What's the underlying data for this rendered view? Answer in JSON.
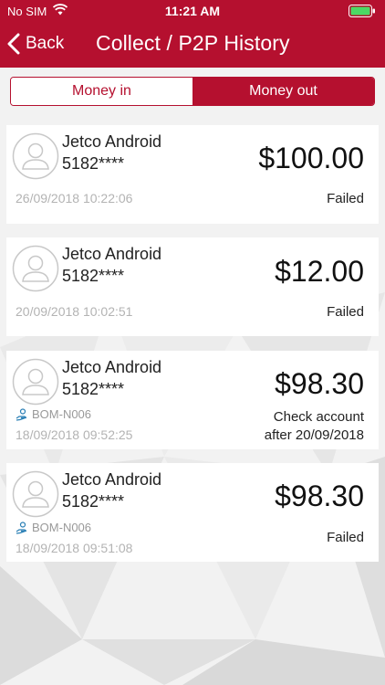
{
  "status_bar": {
    "carrier": "No SIM",
    "time": "11:21 AM",
    "icons": [
      "wifi-icon",
      "battery-icon"
    ]
  },
  "nav": {
    "back_label": "Back",
    "title": "Collect / P2P History",
    "back_icon": "chevron-left-icon"
  },
  "tabs": [
    {
      "label": "Money in",
      "selected": false
    },
    {
      "label": "Money out",
      "selected": true
    }
  ],
  "transactions": [
    {
      "name": "Jetco Android",
      "account": "5182****",
      "ref": "",
      "date": "26/09/2018 10:22:06",
      "amount": "$100.00",
      "status": "Failed"
    },
    {
      "name": "Jetco Android",
      "account": "5182****",
      "ref": "",
      "date": "20/09/2018 10:02:51",
      "amount": "$12.00",
      "status": "Failed"
    },
    {
      "name": "Jetco Android",
      "account": "5182****",
      "ref": "BOM-N006",
      "date": "18/09/2018 09:52:25",
      "amount": "$98.30",
      "status_line1": "Check account",
      "status_line2": "after 20/09/2018"
    },
    {
      "name": "Jetco Android",
      "account": "5182****",
      "ref": "BOM-N006",
      "date": "18/09/2018 09:51:08",
      "amount": "$98.30",
      "status": "Failed"
    }
  ],
  "colors": {
    "brand": "#b5102f",
    "background": "#f2f2f2",
    "card": "#ffffff",
    "muted_text": "#b3b3b3"
  }
}
